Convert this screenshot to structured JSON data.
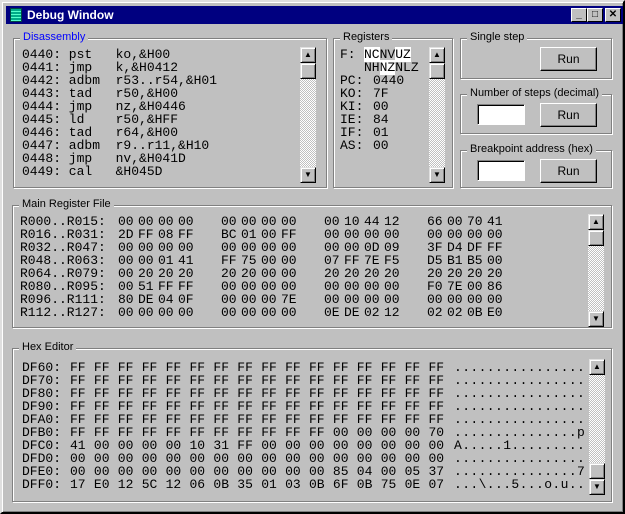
{
  "window": {
    "title": "Debug Window",
    "minimize": "_",
    "maximize": "□",
    "close": "✕"
  },
  "disassembly": {
    "label": "Disassembly",
    "lines": [
      "0440: pst   ko,&H00",
      "0441: jmp   k,&H0412",
      "0442: adbm  r53..r54,&H01",
      "0443: tad   r50,&H00",
      "0444: jmp   nz,&H0446",
      "0445: ld    r50,&HFF",
      "0446: tad   r64,&H00",
      "0447: adbm  r9..r11,&H10",
      "0448: jmp   nv,&H041D",
      "0449: cal   &H045D"
    ]
  },
  "registers": {
    "label": "Registers",
    "flags_label": "F:",
    "flags_line1": [
      {
        "t": "NC",
        "hl": true
      },
      {
        "t": "NV",
        "hl": false
      },
      {
        "t": "UZ",
        "hl": true
      }
    ],
    "flags_line2": [
      {
        "t": "NH",
        "hl": false
      },
      {
        "t": "NZ",
        "hl": true
      },
      {
        "t": "NLZ",
        "hl": false
      }
    ],
    "items": [
      {
        "name": "PC:",
        "value": "0440"
      },
      {
        "name": "KO:",
        "value": "7F"
      },
      {
        "name": "KI:",
        "value": "00"
      },
      {
        "name": "IE:",
        "value": "84"
      },
      {
        "name": "IF:",
        "value": "01"
      },
      {
        "name": "AS:",
        "value": "00"
      }
    ]
  },
  "single_step": {
    "label": "Single step",
    "button": "Run"
  },
  "num_steps": {
    "label": "Number of steps (decimal)",
    "value": "",
    "button": "Run"
  },
  "breakpoint": {
    "label": "Breakpoint address (hex)",
    "value": "",
    "button": "Run"
  },
  "register_file": {
    "label": "Main Register File",
    "rows": [
      {
        "range": "R000..R015:",
        "bytes": [
          "00",
          "00",
          "00",
          "00",
          "00",
          "00",
          "00",
          "00",
          "00",
          "10",
          "44",
          "12",
          "66",
          "00",
          "70",
          "41"
        ]
      },
      {
        "range": "R016..R031:",
        "bytes": [
          "2D",
          "FF",
          "08",
          "FF",
          "BC",
          "01",
          "00",
          "FF",
          "00",
          "00",
          "00",
          "00",
          "00",
          "00",
          "00",
          "00"
        ]
      },
      {
        "range": "R032..R047:",
        "bytes": [
          "00",
          "00",
          "00",
          "00",
          "00",
          "00",
          "00",
          "00",
          "00",
          "00",
          "0D",
          "09",
          "3F",
          "D4",
          "DF",
          "FF"
        ]
      },
      {
        "range": "R048..R063:",
        "bytes": [
          "00",
          "00",
          "01",
          "41",
          "FF",
          "75",
          "00",
          "00",
          "07",
          "FF",
          "7E",
          "F5",
          "D5",
          "B1",
          "B5",
          "00"
        ]
      },
      {
        "range": "R064..R079:",
        "bytes": [
          "00",
          "20",
          "20",
          "20",
          "20",
          "20",
          "00",
          "00",
          "20",
          "20",
          "20",
          "20",
          "20",
          "20",
          "20",
          "20"
        ]
      },
      {
        "range": "R080..R095:",
        "bytes": [
          "00",
          "51",
          "FF",
          "FF",
          "00",
          "00",
          "00",
          "00",
          "00",
          "00",
          "00",
          "00",
          "F0",
          "7E",
          "00",
          "86"
        ]
      },
      {
        "range": "R096..R111:",
        "bytes": [
          "80",
          "DE",
          "04",
          "0F",
          "00",
          "00",
          "00",
          "7E",
          "00",
          "00",
          "00",
          "00",
          "00",
          "00",
          "00",
          "00"
        ]
      },
      {
        "range": "R112..R127:",
        "bytes": [
          "00",
          "00",
          "00",
          "00",
          "00",
          "00",
          "00",
          "00",
          "0E",
          "DE",
          "02",
          "12",
          "02",
          "02",
          "0B",
          "E0"
        ]
      }
    ]
  },
  "hex_editor": {
    "label": "Hex Editor",
    "rows": [
      {
        "addr": "DF60:",
        "bytes": [
          "FF",
          "FF",
          "FF",
          "FF",
          "FF",
          "FF",
          "FF",
          "FF",
          "FF",
          "FF",
          "FF",
          "FF",
          "FF",
          "FF",
          "FF",
          "FF"
        ],
        "ascii": "................"
      },
      {
        "addr": "DF70:",
        "bytes": [
          "FF",
          "FF",
          "FF",
          "FF",
          "FF",
          "FF",
          "FF",
          "FF",
          "FF",
          "FF",
          "FF",
          "FF",
          "FF",
          "FF",
          "FF",
          "FF"
        ],
        "ascii": "................"
      },
      {
        "addr": "DF80:",
        "bytes": [
          "FF",
          "FF",
          "FF",
          "FF",
          "FF",
          "FF",
          "FF",
          "FF",
          "FF",
          "FF",
          "FF",
          "FF",
          "FF",
          "FF",
          "FF",
          "FF"
        ],
        "ascii": "................"
      },
      {
        "addr": "DF90:",
        "bytes": [
          "FF",
          "FF",
          "FF",
          "FF",
          "FF",
          "FF",
          "FF",
          "FF",
          "FF",
          "FF",
          "FF",
          "FF",
          "FF",
          "FF",
          "FF",
          "FF"
        ],
        "ascii": "................"
      },
      {
        "addr": "DFA0:",
        "bytes": [
          "FF",
          "FF",
          "FF",
          "FF",
          "FF",
          "FF",
          "FF",
          "FF",
          "FF",
          "FF",
          "FF",
          "FF",
          "FF",
          "FF",
          "FF",
          "FF"
        ],
        "ascii": "................"
      },
      {
        "addr": "DFB0:",
        "bytes": [
          "FF",
          "FF",
          "FF",
          "FF",
          "FF",
          "FF",
          "FF",
          "FF",
          "FF",
          "FF",
          "FF",
          "00",
          "00",
          "00",
          "00",
          "70"
        ],
        "ascii": "...............p"
      },
      {
        "addr": "DFC0:",
        "bytes": [
          "41",
          "00",
          "00",
          "00",
          "00",
          "10",
          "31",
          "FF",
          "00",
          "00",
          "00",
          "00",
          "00",
          "00",
          "00",
          "00"
        ],
        "ascii": "A.....1........."
      },
      {
        "addr": "DFD0:",
        "bytes": [
          "00",
          "00",
          "00",
          "00",
          "00",
          "00",
          "00",
          "00",
          "00",
          "00",
          "00",
          "00",
          "00",
          "00",
          "00",
          "00"
        ],
        "ascii": "................"
      },
      {
        "addr": "DFE0:",
        "bytes": [
          "00",
          "00",
          "00",
          "00",
          "00",
          "00",
          "00",
          "00",
          "00",
          "00",
          "00",
          "85",
          "04",
          "00",
          "05",
          "37"
        ],
        "ascii": "...............7"
      },
      {
        "addr": "DFF0:",
        "bytes": [
          "17",
          "E0",
          "12",
          "5C",
          "12",
          "06",
          "0B",
          "35",
          "01",
          "03",
          "0B",
          "6F",
          "0B",
          "75",
          "0E",
          "07"
        ],
        "ascii": "...\\...5...o.u.."
      }
    ]
  }
}
